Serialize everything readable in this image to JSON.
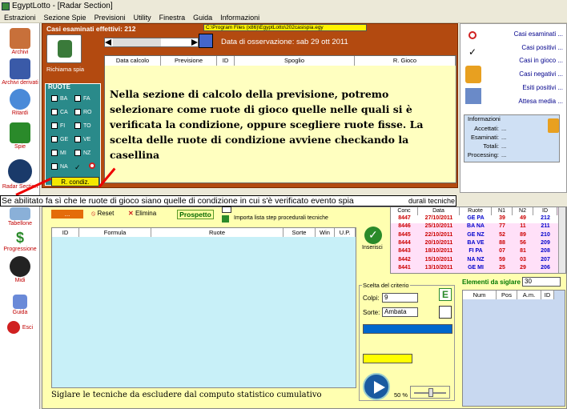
{
  "window": {
    "title": "EgyptLotto - [Radar Section]"
  },
  "menu": [
    "Estrazioni",
    "Sezione Spie",
    "Previsioni",
    "Utility",
    "Finestra",
    "Guida",
    "Informazioni"
  ],
  "sidebar": [
    "Archivi",
    "Archivi derivati",
    "Ritardi",
    "Spie",
    "Radar Section",
    "Tabellone",
    "Progressione",
    "Midi",
    "Guida",
    "Esci"
  ],
  "top": {
    "casi": "Casi esaminati effettivi: 212",
    "path": "C:\\Program Files (x86)\\EgyptLotto\\202casispia.egy",
    "obs_date": "Data di osservazione:  sab 29 ott 2011",
    "richiama": "Richiama spia",
    "columns": [
      "Data calcolo",
      "Previsione",
      "ID",
      "Spoglio",
      "R. Gioco"
    ]
  },
  "ruote": {
    "title": "RUOTE",
    "items": [
      "BA",
      "FA",
      "CA",
      "RO",
      "FI",
      "TO",
      "GE",
      "VE",
      "MI",
      "NZ",
      "NA",
      "✓"
    ],
    "button": "R. condiz."
  },
  "overlay": "Nella sezione di calcolo della previsione, potremo selezionare come ruote di gioco quelle nelle quali si è verificata la condizione, oppure scegliere ruote fisse. La scelta delle ruote di condizione avviene checkando la casellina",
  "caption": "Se abilitato fa sì che le ruote di gioco siano quelle di condizione in cui s'è verificato evento spia",
  "caption_tail": "durali tecniche",
  "right": {
    "links": [
      "Casi esaminati ...",
      "Casi positivi ...",
      "Casi in gioco ...",
      "Casi negativi ...",
      "Esiti positivi ...",
      "Attesa media ..."
    ],
    "info_title": "Informazioni",
    "info": [
      [
        "Accettati:",
        "..."
      ],
      [
        "Esaminati:",
        "..."
      ],
      [
        "Totali:",
        "..."
      ],
      [
        "Processing:",
        "..."
      ]
    ]
  },
  "bottom": {
    "file_btn": "...",
    "reset": "Reset",
    "elimina": "Elimina",
    "prospetto": "Prospetto",
    "importa": "Importa lista step procedurali tecniche",
    "columns": [
      "ID",
      "Formula",
      "Ruote",
      "Sorte",
      "Win",
      "U.P."
    ],
    "inserisci": "Inserisci",
    "footer": "Siglare le tecniche da escludere dal computo statistico cumulativo"
  },
  "conc": {
    "columns": [
      "Conc",
      "Data",
      "Ruote",
      "N1",
      "N2",
      "ID"
    ],
    "rows": [
      [
        "8447",
        "27/10/2011",
        "GE PA",
        "39",
        "49",
        "212"
      ],
      [
        "8446",
        "25/10/2011",
        "BA NA",
        "77",
        "11",
        "211"
      ],
      [
        "8445",
        "22/10/2011",
        "GE NZ",
        "52",
        "89",
        "210"
      ],
      [
        "8444",
        "20/10/2011",
        "BA VE",
        "88",
        "56",
        "209"
      ],
      [
        "8443",
        "18/10/2011",
        "FI PA",
        "07",
        "81",
        "208"
      ],
      [
        "8442",
        "15/10/2011",
        "NA NZ",
        "59",
        "03",
        "207"
      ],
      [
        "8441",
        "13/10/2011",
        "GE MI",
        "25",
        "29",
        "206"
      ]
    ]
  },
  "criterio": {
    "title": "Scelta del criterio",
    "colpi_label": "Colpi:",
    "colpi": "9",
    "sorte_label": "Sorte:",
    "sorte": "Ambata",
    "pct": "50 %",
    "e_btn": "E"
  },
  "elementi": {
    "label": "Elementi da siglare",
    "value": "30",
    "columns": [
      "Num",
      "Pos",
      "A.m.",
      "ID"
    ]
  },
  "colors": {
    "frame": "#b34a10",
    "accent": "#2a8a8a"
  }
}
